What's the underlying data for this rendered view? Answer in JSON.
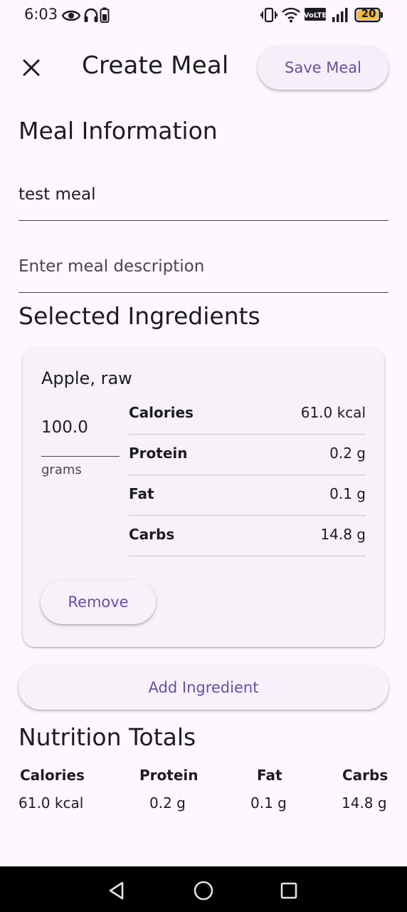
{
  "status_bar": {
    "time": "6:03",
    "battery_level": "20"
  },
  "app_bar": {
    "title": "Create Meal",
    "save_label": "Save Meal"
  },
  "meal_info": {
    "section_title": "Meal Information",
    "name_value": "test meal",
    "description_placeholder": "Enter meal description"
  },
  "ingredients": {
    "section_title": "Selected Ingredients",
    "items": [
      {
        "name": "Apple, raw",
        "quantity": "100.0",
        "unit": "grams",
        "nutrients": [
          {
            "label": "Calories",
            "value": "61.0 kcal"
          },
          {
            "label": "Protein",
            "value": "0.2 g"
          },
          {
            "label": "Fat",
            "value": "0.1 g"
          },
          {
            "label": "Carbs",
            "value": "14.8 g"
          }
        ],
        "remove_label": "Remove"
      }
    ],
    "add_label": "Add Ingredient"
  },
  "totals": {
    "section_title": "Nutrition Totals",
    "columns": [
      {
        "label": "Calories",
        "value": "61.0 kcal"
      },
      {
        "label": "Protein",
        "value": "0.2 g"
      },
      {
        "label": "Fat",
        "value": "0.1 g"
      },
      {
        "label": "Carbs",
        "value": "14.8 g"
      }
    ]
  },
  "colors": {
    "background": "#fef7ff",
    "primary": "#6750a4",
    "on_surface": "#1d1b20",
    "battery_fill": "#f5b82e"
  },
  "icons": {
    "status": [
      "eye-icon",
      "headphones-icon",
      "battery-small-icon",
      "vibrate-icon",
      "wifi-icon",
      "volte-icon",
      "signal-icon",
      "battery-icon"
    ],
    "app_bar": [
      "close-icon"
    ],
    "nav": [
      "back-icon",
      "home-icon",
      "recents-icon"
    ]
  }
}
